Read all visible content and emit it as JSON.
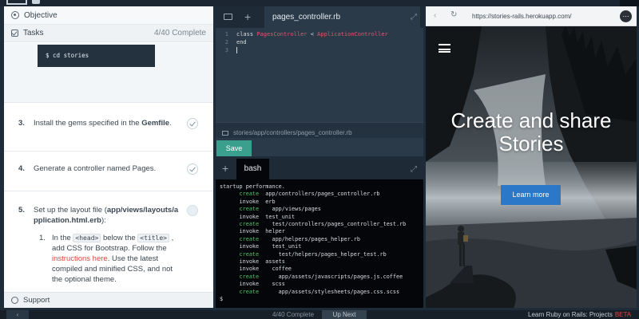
{
  "objective": {
    "label": "Objective"
  },
  "tasks": {
    "label": "Tasks",
    "count": "4/40 Complete",
    "command": "$ cd stories",
    "items": [
      {
        "num": "3.",
        "text": "Install the gems specified in the",
        "bold": "Gemfile",
        "suffix": "."
      },
      {
        "num": "4.",
        "text": "Generate a controller named Pages."
      },
      {
        "num": "5.",
        "text": "Set up the layout file (",
        "bold": "app/views/layouts/application.html.erb",
        "suffix": "):",
        "sub": {
          "num": "1.",
          "p1": "In the ",
          "code1": "<head>",
          "p2": " below the ",
          "code2": "<title>",
          "p3": " , add CSS for Bootstrap. Follow the ",
          "link": "instructions here",
          "p4": ". Use the latest compiled and minified CSS, and not the optional theme."
        }
      }
    ]
  },
  "support": {
    "label": "Support"
  },
  "editor": {
    "tab": "pages_controller.rb",
    "lines": [
      {
        "n": "1",
        "a": "class ",
        "b": "PagesController",
        "c": " < ",
        "d": "ApplicationController"
      },
      {
        "n": "2",
        "a": "end"
      },
      {
        "n": "3",
        "a": ""
      }
    ],
    "path": "stories/app/controllers/pages_controller.rb",
    "save": "Save"
  },
  "terminal": {
    "tab": "bash",
    "lines": [
      {
        "a": "",
        "b": "startup performance."
      },
      {
        "a": "      create",
        "b": "  app/controllers/pages_controller.rb"
      },
      {
        "a": "",
        "b": "      invoke  erb"
      },
      {
        "a": "      create",
        "b": "    app/views/pages"
      },
      {
        "a": "",
        "b": "      invoke  test_unit"
      },
      {
        "a": "      create",
        "b": "    test/controllers/pages_controller_test.rb"
      },
      {
        "a": "",
        "b": "      invoke  helper"
      },
      {
        "a": "      create",
        "b": "    app/helpers/pages_helper.rb"
      },
      {
        "a": "",
        "b": "      invoke    test_unit"
      },
      {
        "a": "      create",
        "b": "      test/helpers/pages_helper_test.rb"
      },
      {
        "a": "",
        "b": "      invoke  assets"
      },
      {
        "a": "",
        "b": "      invoke    coffee"
      },
      {
        "a": "      create",
        "b": "      app/assets/javascripts/pages.js.coffee"
      },
      {
        "a": "",
        "b": "      invoke    scss"
      },
      {
        "a": "      create",
        "b": "      app/assets/stylesheets/pages.css.scss"
      },
      {
        "a": "",
        "b": "$"
      }
    ]
  },
  "browser": {
    "url": "https://stories-rails.herokuapp.com/",
    "hero_title_1": "Create and share",
    "hero_title_2": "Stories",
    "cta": "Learn more"
  },
  "bottom": {
    "count": "4/40 Complete",
    "up_next": "Up Next",
    "course": "Learn Ruby on Rails: Projects",
    "beta": "BETA"
  }
}
